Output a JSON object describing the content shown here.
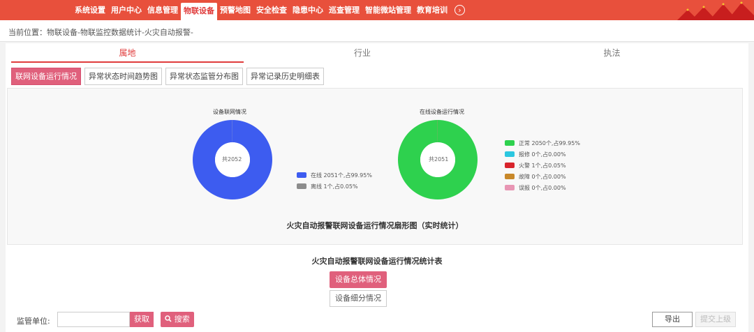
{
  "nav": {
    "items": [
      {
        "label": "系统设置",
        "active": false
      },
      {
        "label": "用户中心",
        "active": false
      },
      {
        "label": "信息管理",
        "active": false
      },
      {
        "label": "物联设备",
        "active": true
      },
      {
        "label": "预警地图",
        "active": false
      },
      {
        "label": "安全检查",
        "active": false
      },
      {
        "label": "隐患中心",
        "active": false
      },
      {
        "label": "巡查管理",
        "active": false
      },
      {
        "label": "智能微站管理",
        "active": false
      },
      {
        "label": "教育培训",
        "active": false
      }
    ],
    "more_icon": "chevron-right-circle-icon",
    "accent": "#e8503c"
  },
  "breadcrumb": "当前位置：物联设备-物联监控数据统计-火灾自动报警-",
  "tabs": [
    {
      "label": "属地",
      "active": true
    },
    {
      "label": "行业",
      "active": false
    },
    {
      "label": "执法",
      "active": false
    }
  ],
  "subtabs": [
    {
      "label": "联网设备运行情况",
      "active": true
    },
    {
      "label": "异常状态时间趋势图",
      "active": false
    },
    {
      "label": "异常状态监管分布图",
      "active": false
    },
    {
      "label": "异常记录历史明细表",
      "active": false
    }
  ],
  "chart_data": [
    {
      "type": "pie",
      "title": "设备联网情况",
      "center_label": "共2052",
      "series": [
        {
          "name": "在线",
          "value": 2051,
          "legend": "在线  2051个,占99.95%",
          "color": "#3d5cf0"
        },
        {
          "name": "离线",
          "value": 1,
          "legend": "离线  1个,占0.05%",
          "color": "#8c8c8c"
        }
      ]
    },
    {
      "type": "pie",
      "title": "在线设备运行情况",
      "center_label": "共2051",
      "series": [
        {
          "name": "正常",
          "value": 2050,
          "legend": "正常  2050个,占99.95%",
          "color": "#2ed14e"
        },
        {
          "name": "报修",
          "value": 0,
          "legend": "报修  0个,占0.00%",
          "color": "#2cc7e0"
        },
        {
          "name": "火警",
          "value": 1,
          "legend": "火警  1个,占0.05%",
          "color": "#d8242c"
        },
        {
          "name": "故障",
          "value": 0,
          "legend": "故障  0个,占0.00%",
          "color": "#c8882a"
        },
        {
          "name": "误报",
          "value": 0,
          "legend": "误报  0个,占0.00%",
          "color": "#e896b4"
        }
      ]
    }
  ],
  "chart_main_title": "火灾自动报警联网设备运行情况扇形图（实时统计）",
  "table_title": "火灾自动报警联网设备运行情况统计表",
  "buttons": {
    "overall": "设备总体情况",
    "detail": "设备细分情况",
    "fetch": "获取",
    "search": "搜索",
    "search_icon": "search-icon",
    "export": "导出",
    "upload": "提交上级"
  },
  "filter": {
    "label": "监管单位:",
    "value": "",
    "placeholder": ""
  }
}
